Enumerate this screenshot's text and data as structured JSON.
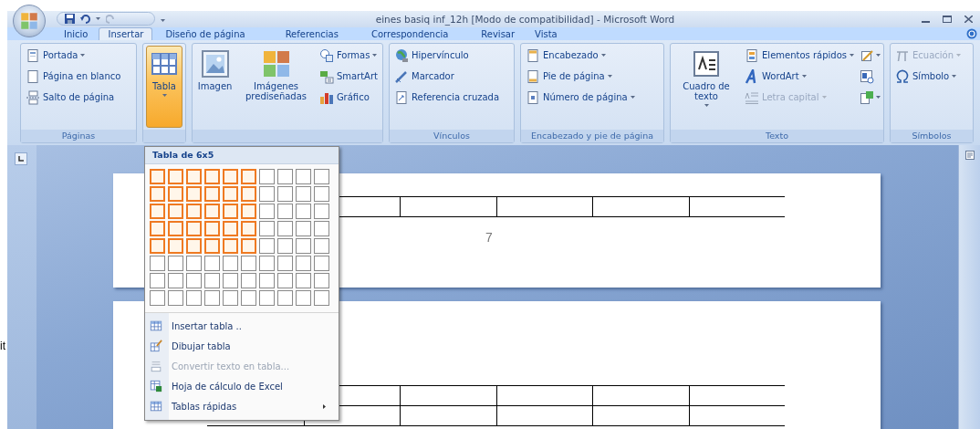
{
  "background_text": "it",
  "window": {
    "title": "eines basiq inf_12h [Modo de compatibilidad] - Microsoft Word"
  },
  "tabs": [
    {
      "label": "Inicio",
      "selected": false
    },
    {
      "label": "Insertar",
      "selected": true
    },
    {
      "label": "Diseño de página",
      "selected": false
    },
    {
      "label": "Referencias",
      "selected": false
    },
    {
      "label": "Correspondencia",
      "selected": false
    },
    {
      "label": "Revisar",
      "selected": false
    },
    {
      "label": "Vista",
      "selected": false
    }
  ],
  "ribbon": {
    "groups": [
      {
        "label": "Páginas",
        "columns": [
          {
            "kind": "stack",
            "items": [
              {
                "label": "Portada",
                "dropdown": true,
                "disabled": false
              },
              {
                "label": "Página en blanco",
                "dropdown": false,
                "disabled": false
              },
              {
                "label": "Salto de página",
                "dropdown": false,
                "disabled": false
              }
            ]
          }
        ]
      },
      {
        "columns": [
          {
            "kind": "large",
            "items": [
              {
                "label": "Tabla",
                "dropdown": true,
                "disabled": false,
                "pressed": true
              }
            ]
          }
        ]
      },
      {
        "columns": [
          {
            "kind": "large",
            "items": [
              {
                "label": "Imagen",
                "dropdown": false,
                "disabled": false,
                "pressed": false
              }
            ]
          },
          {
            "kind": "large",
            "items": [
              {
                "label": "Imágenes prediseñadas",
                "dropdown": false,
                "disabled": false,
                "pressed": false
              }
            ]
          },
          {
            "kind": "stack",
            "items": [
              {
                "label": "Formas",
                "dropdown": true,
                "disabled": false
              },
              {
                "label": "SmartArt",
                "dropdown": false,
                "disabled": false
              },
              {
                "label": "Gráfico",
                "dropdown": false,
                "disabled": false
              }
            ]
          }
        ]
      },
      {
        "label": "Vínculos",
        "columns": [
          {
            "kind": "stack",
            "items": [
              {
                "label": "Hipervínculo",
                "dropdown": false,
                "disabled": false
              },
              {
                "label": "Marcador",
                "dropdown": false,
                "disabled": false
              },
              {
                "label": "Referencia cruzada",
                "dropdown": false,
                "disabled": false
              }
            ]
          }
        ]
      },
      {
        "label": "Encabezado y pie de página",
        "columns": [
          {
            "kind": "stack",
            "items": [
              {
                "label": "Encabezado",
                "dropdown": true,
                "disabled": false
              },
              {
                "label": "Pie de página",
                "dropdown": true,
                "disabled": false
              },
              {
                "label": "Número de página",
                "dropdown": true,
                "disabled": false
              }
            ]
          }
        ]
      },
      {
        "label": "Texto",
        "columns": [
          {
            "kind": "large",
            "items": [
              {
                "label": "Cuadro de texto",
                "dropdown": true,
                "disabled": false,
                "pressed": false
              }
            ]
          },
          {
            "kind": "stack",
            "items": [
              {
                "label": "Elementos rápidos",
                "dropdown": true,
                "disabled": false
              },
              {
                "label": "WordArt",
                "dropdown": true,
                "disabled": false
              },
              {
                "label": "Letra capital",
                "dropdown": true,
                "disabled": true
              }
            ]
          },
          {
            "kind": "icons",
            "items": [
              {
                "dropdown": true,
                "disabled": false
              },
              {
                "dropdown": false,
                "disabled": false
              },
              {
                "dropdown": true,
                "disabled": false
              }
            ]
          }
        ]
      },
      {
        "label": "Símbolos",
        "columns": [
          {
            "kind": "stack",
            "items": [
              {
                "label": "Ecuación",
                "dropdown": true,
                "disabled": true
              },
              {
                "label": "Símbolo",
                "dropdown": true,
                "disabled": false
              }
            ]
          }
        ]
      }
    ]
  },
  "document": {
    "page_number": "7"
  },
  "menu": {
    "header": "Tabla de 6x5",
    "grid": [
      {
        "cells": [
          {
            "selected": true
          },
          {
            "selected": true
          },
          {
            "selected": true
          },
          {
            "selected": true
          },
          {
            "selected": true
          },
          {
            "selected": true
          },
          {
            "selected": false
          },
          {
            "selected": false
          },
          {
            "selected": false
          },
          {
            "selected": false
          }
        ]
      },
      {
        "cells": [
          {
            "selected": true
          },
          {
            "selected": true
          },
          {
            "selected": true
          },
          {
            "selected": true
          },
          {
            "selected": true
          },
          {
            "selected": true
          },
          {
            "selected": false
          },
          {
            "selected": false
          },
          {
            "selected": false
          },
          {
            "selected": false
          }
        ]
      },
      {
        "cells": [
          {
            "selected": true
          },
          {
            "selected": true
          },
          {
            "selected": true
          },
          {
            "selected": true
          },
          {
            "selected": true
          },
          {
            "selected": true
          },
          {
            "selected": false
          },
          {
            "selected": false
          },
          {
            "selected": false
          },
          {
            "selected": false
          }
        ]
      },
      {
        "cells": [
          {
            "selected": true
          },
          {
            "selected": true
          },
          {
            "selected": true
          },
          {
            "selected": true
          },
          {
            "selected": true
          },
          {
            "selected": true
          },
          {
            "selected": false
          },
          {
            "selected": false
          },
          {
            "selected": false
          },
          {
            "selected": false
          }
        ]
      },
      {
        "cells": [
          {
            "selected": true
          },
          {
            "selected": true
          },
          {
            "selected": true
          },
          {
            "selected": true
          },
          {
            "selected": true
          },
          {
            "selected": true
          },
          {
            "selected": false
          },
          {
            "selected": false
          },
          {
            "selected": false
          },
          {
            "selected": false
          }
        ]
      },
      {
        "cells": [
          {
            "selected": false
          },
          {
            "selected": false
          },
          {
            "selected": false
          },
          {
            "selected": false
          },
          {
            "selected": false
          },
          {
            "selected": false
          },
          {
            "selected": false
          },
          {
            "selected": false
          },
          {
            "selected": false
          },
          {
            "selected": false
          }
        ]
      },
      {
        "cells": [
          {
            "selected": false
          },
          {
            "selected": false
          },
          {
            "selected": false
          },
          {
            "selected": false
          },
          {
            "selected": false
          },
          {
            "selected": false
          },
          {
            "selected": false
          },
          {
            "selected": false
          },
          {
            "selected": false
          },
          {
            "selected": false
          }
        ]
      },
      {
        "cells": [
          {
            "selected": false
          },
          {
            "selected": false
          },
          {
            "selected": false
          },
          {
            "selected": false
          },
          {
            "selected": false
          },
          {
            "selected": false
          },
          {
            "selected": false
          },
          {
            "selected": false
          },
          {
            "selected": false
          },
          {
            "selected": false
          }
        ]
      }
    ],
    "items": [
      {
        "label": "Insertar tabla ..",
        "disabled": false,
        "submenu": false
      },
      {
        "label": "Dibujar tabla",
        "disabled": false,
        "submenu": false
      },
      {
        "label": "Convertir texto en tabla...",
        "disabled": true,
        "submenu": false
      },
      {
        "label": "Hoja de cálculo de Excel",
        "disabled": false,
        "submenu": false
      },
      {
        "label": "Tablas rápidas",
        "disabled": false,
        "submenu": true
      }
    ]
  }
}
